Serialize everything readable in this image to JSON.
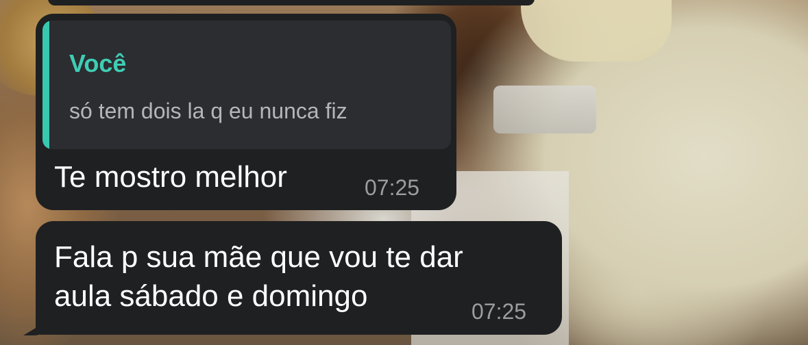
{
  "messages": [
    {
      "reply": {
        "author": "Você",
        "text": "só tem dois la q eu nunca fiz",
        "accent_color": "#3fcdb5"
      },
      "lines": [
        "Te mostro melhor"
      ],
      "time": "07:25"
    },
    {
      "lines": [
        "Fala p sua mãe que vou te dar",
        "aula sábado e domingo"
      ],
      "time": "07:25"
    }
  ],
  "colors": {
    "bubble": "#1f2022",
    "quote_background": "#2c2d30",
    "quote_bar": "#38c8b0",
    "message_text": "#ffffff",
    "timestamp": "#9c9da1"
  }
}
